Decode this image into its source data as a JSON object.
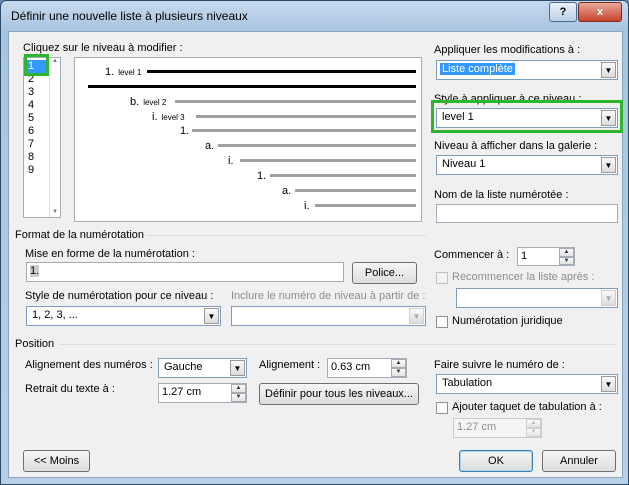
{
  "window": {
    "title": "Définir une nouvelle liste à plusieurs niveaux",
    "help": "?",
    "close": "x"
  },
  "level_list": {
    "label": "Cliquez sur le niveau à modifier :",
    "items": [
      "1",
      "2",
      "3",
      "4",
      "5",
      "6",
      "7",
      "8",
      "9"
    ],
    "selected": "1"
  },
  "preview": [
    {
      "num": "1.",
      "tag": "level 1"
    },
    {
      "num": "b.",
      "tag": "level 2"
    },
    {
      "num": "i.",
      "tag": "level 3"
    },
    {
      "num": "1.",
      "tag": ""
    },
    {
      "num": "a.",
      "tag": ""
    },
    {
      "num": "i.",
      "tag": ""
    },
    {
      "num": "1.",
      "tag": ""
    },
    {
      "num": "a.",
      "tag": ""
    },
    {
      "num": "i.",
      "tag": ""
    }
  ],
  "right": {
    "apply_label": "Appliquer les modifications à :",
    "apply_value": "Liste complète",
    "style_label": "Style à appliquer à ce niveau :",
    "style_value": "level 1",
    "gallery_label": "Niveau à afficher dans la galerie :",
    "gallery_value": "Niveau 1",
    "listname_label": "Nom de la liste numérotée :",
    "listname_value": ""
  },
  "format": {
    "section": "Format de la numérotation",
    "mise_label": "Mise en forme de la numérotation :",
    "mise_value": "1.",
    "police_button": "Police...",
    "style_label": "Style de numérotation pour ce niveau :",
    "style_value": "1, 2, 3, ...",
    "include_label": "Inclure le numéro de niveau à partir de :",
    "include_value": "",
    "start_label": "Commencer à :",
    "start_value": "1",
    "restart_label": "Recommencer la liste après :",
    "restart_value": "",
    "legal_label": "Numérotation juridique"
  },
  "position": {
    "section": "Position",
    "align_label": "Alignement des numéros :",
    "align_value": "Gauche",
    "at_label": "Alignement :",
    "at_value": "0.63 cm",
    "indent_label": "Retrait du texte à :",
    "indent_value": "1.27 cm",
    "all_levels_button": "Définir pour tous les niveaux...",
    "follow_label": "Faire suivre le numéro de :",
    "follow_value": "Tabulation",
    "tab_label": "Ajouter taquet de tabulation à :",
    "tab_value": "1.27 cm"
  },
  "buttons": {
    "less": "<< Moins",
    "ok": "OK",
    "cancel": "Annuler"
  },
  "colors": {
    "highlight": "#2db52d",
    "selection": "#3399ff"
  }
}
